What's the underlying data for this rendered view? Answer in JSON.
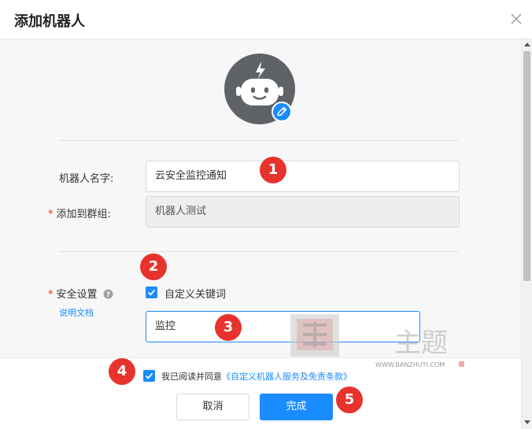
{
  "dialog": {
    "title": "添加机器人"
  },
  "form": {
    "name_label": "机器人名字:",
    "name_value": "云安全监控通知",
    "group_label": "添加到群组:",
    "group_value": "机器人测试",
    "security_label": "安全设置",
    "doc_link": "说明文档",
    "keyword_checkbox_label": "自定义关键词",
    "keyword_value": "监控",
    "required_mark": "*"
  },
  "footer": {
    "agree_prefix": "我已阅读并同意",
    "agree_link": "《自定义机器人服务及免责条款》",
    "cancel_label": "取消",
    "confirm_label": "完成"
  },
  "markers": [
    "1",
    "2",
    "3",
    "4",
    "5"
  ],
  "watermark": {
    "url_text": "WWW.BANZHUTI.COM",
    "chars": "主题"
  },
  "colors": {
    "accent": "#1a8cff",
    "marker": "#e8322e",
    "avatar": "#5f6368"
  },
  "icons": [
    "close-icon",
    "robot-icon",
    "pencil-icon",
    "help-icon",
    "check-icon"
  ]
}
